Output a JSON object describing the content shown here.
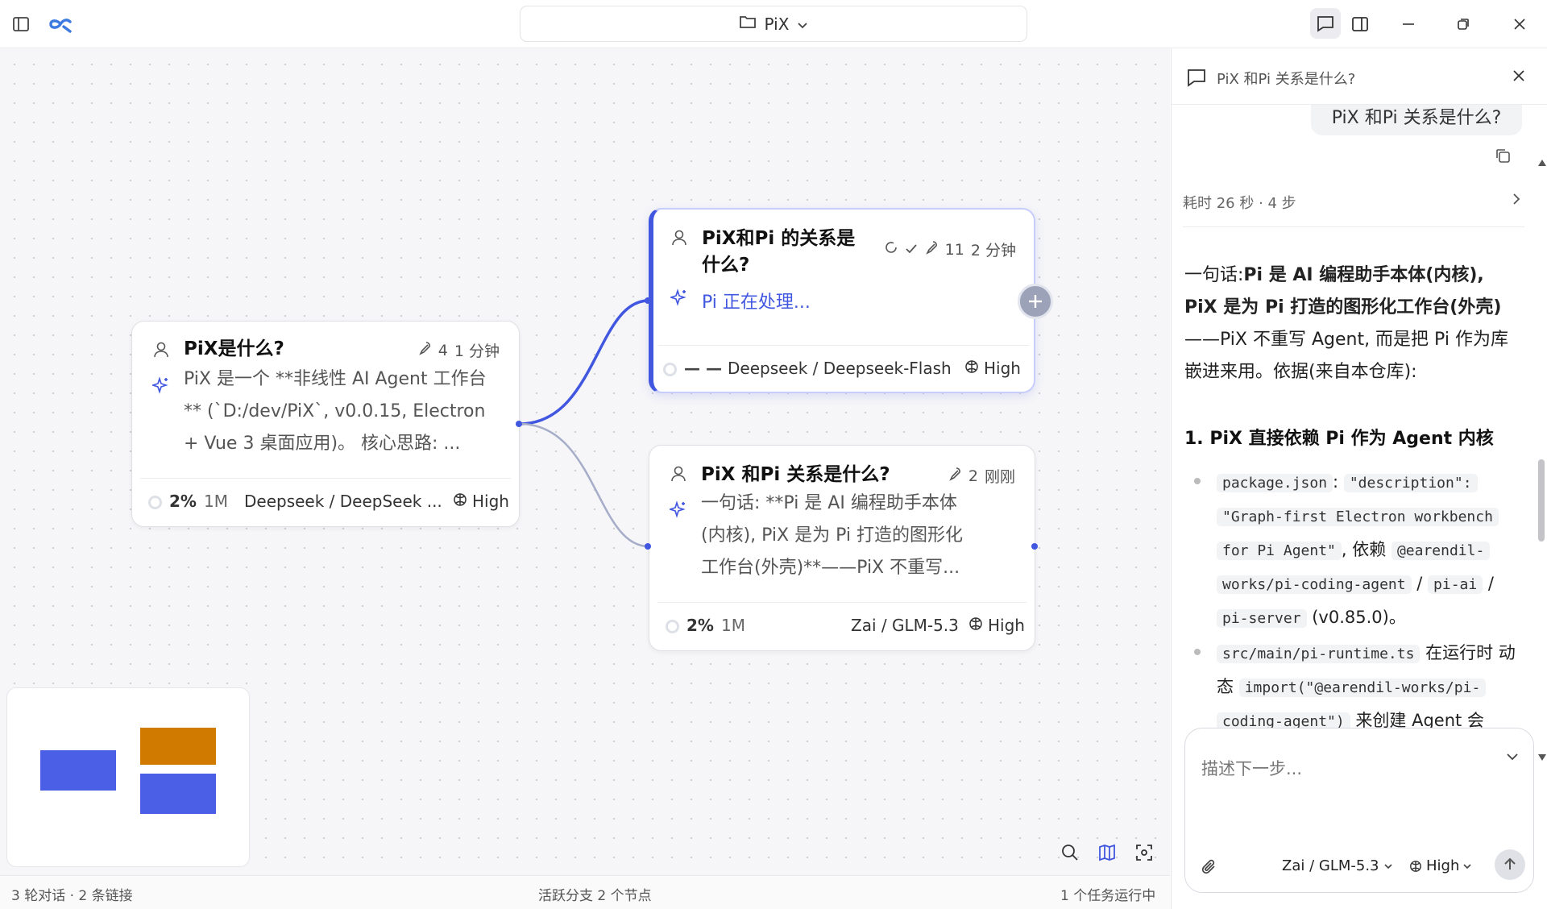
{
  "window": {
    "title": "PiX"
  },
  "canvas": {
    "nodes": [
      {
        "id": "n1",
        "question": "PiX是什么?",
        "tools": "4",
        "time": "1 分钟",
        "answer": [
          "PiX 是一个 **非线性 AI Agent 工作台",
          "** (`D:/dev/PiX`, v0.0.15, Electron",
          "+ Vue 3 桌面应用)。 核心思路: ..."
        ],
        "progress": "2%",
        "tokens": "1M",
        "model": "Deepseek / DeepSeek ...",
        "effort": "High"
      },
      {
        "id": "n2",
        "question_line1": "PiX和Pi 的关系是",
        "question_line2": "什么?",
        "tools": "11",
        "time": "2 分钟",
        "answer": "Pi 正在处理...",
        "progress": "— —",
        "model": "Deepseek / Deepseek-Flash",
        "effort": "High"
      },
      {
        "id": "n3",
        "question": "PiX 和Pi 关系是什么?",
        "tools": "2",
        "time": "刚刚",
        "answer": [
          "一句话: **Pi 是 AI 编程助手本体",
          "(内核), PiX 是为 Pi 打造的图形化",
          "工作台(外壳)**——PiX 不重写..."
        ],
        "progress": "2%",
        "tokens": "1M",
        "model": "Zai / GLM-5.3",
        "effort": "High"
      }
    ]
  },
  "status": {
    "left": "3 轮对话 · 2 条链接",
    "center": "活跃分支 2 个节点",
    "right": "1 个任务运行中"
  },
  "panel": {
    "header_title": "PiX 和Pi 关系是什么?",
    "user_message": "PiX 和Pi 关系是什么?",
    "thinking_summary": "耗时 26 秒 · 4 步",
    "answer_intro_plain": "一句话:",
    "answer_intro_bold": "Pi 是 AI 编程助手本体(内核), PiX 是为 Pi 打造的图形化工作台(外壳)",
    "answer_intro_rest": "——PiX 不重写 Agent, 而是把 Pi 作为库嵌进来用。依据(来自本仓库):",
    "section1_heading": "1. PiX 直接依赖 Pi 作为 Agent 内核",
    "bullet1": {
      "c1": "package.json",
      "t1": ":",
      "c2": "\"description\":",
      "c3": "\"Graph-first Electron workbench",
      "c4": "for Pi Agent\"",
      "t2": ", 依赖",
      "c5": "@earendil-",
      "c6": "works/pi-coding-agent",
      "t3": "/",
      "c7": "pi-ai",
      "t4": "/",
      "c8": "pi-server",
      "t5": "(v0.85.0)。"
    },
    "bullet2": {
      "c1": "src/main/pi-runtime.ts",
      "t1": "在运行时",
      "t2": "动态",
      "c2": "import(\"@earendil-works/pi-",
      "c3": "coding-agent\")",
      "t3": "来创建 Agent 会"
    },
    "composer_placeholder": "描述下一步...",
    "model_select": "Zai / GLM-5.3",
    "effort_select": "High"
  },
  "colors": {
    "accent": "#4257e0",
    "minimap_orange": "#d17a00",
    "minimap_blue": "#4b5ee6"
  }
}
